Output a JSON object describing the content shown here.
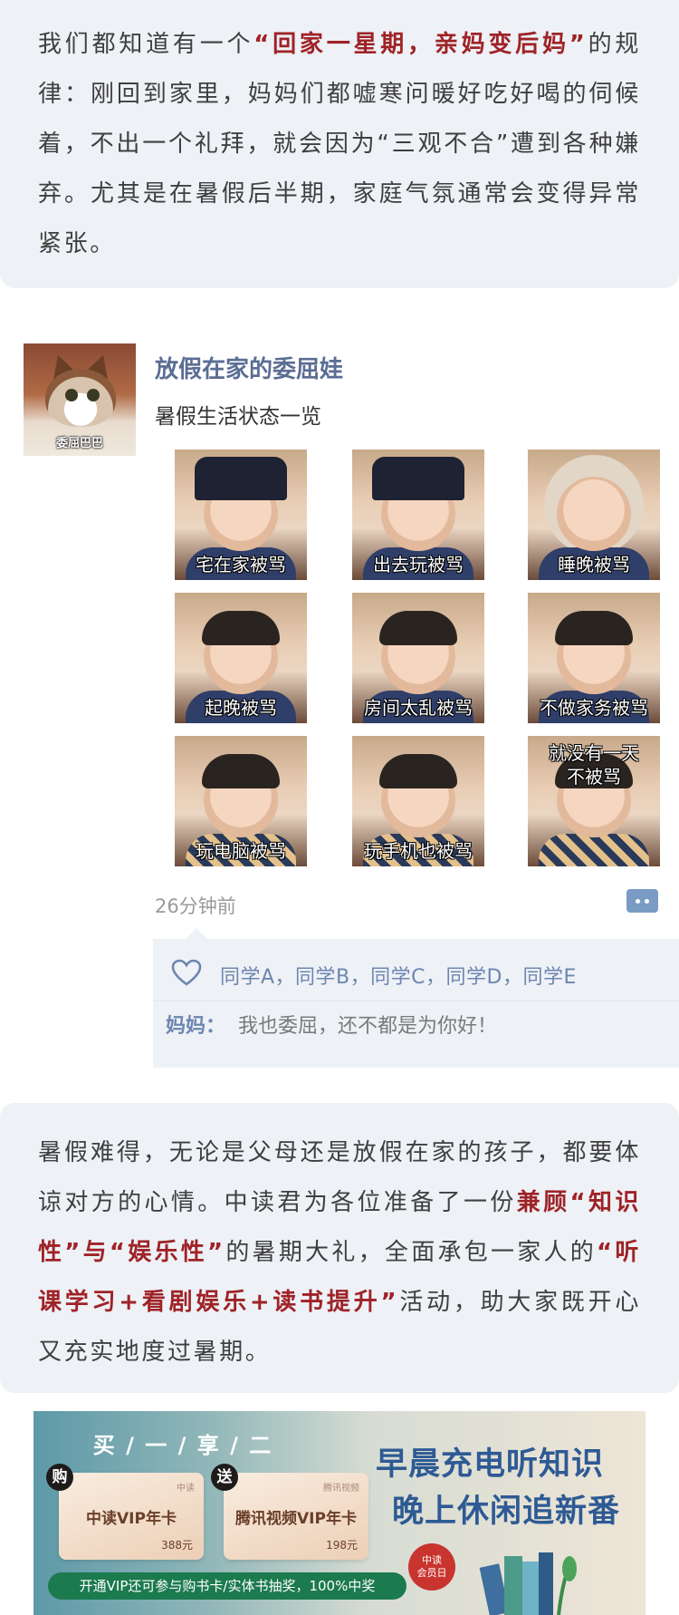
{
  "intro": {
    "pre": "我们都知道有一个",
    "highlight": "“回家一星期，亲妈变后妈”",
    "post": "的规律：刚回到家里，妈妈们都嘘寒问暖好吃好喝的伺候着，不出一个礼拜，就会因为“三观不合”遭到各种嫌弃。尤其是在暑假后半期，家庭气氛通常会变得异常紧张。"
  },
  "post": {
    "avatar_caption": "委屈巴巴",
    "nickname": "放假在家的委屈娃",
    "text": "暑假生活状态一览",
    "images": [
      {
        "caption": "宅在家被骂",
        "style": "hat"
      },
      {
        "caption": "出去玩被骂",
        "style": "hat"
      },
      {
        "caption": "睡晚被骂",
        "style": "hood"
      },
      {
        "caption": "起晚被骂",
        "style": "hair"
      },
      {
        "caption": "房间太乱被骂",
        "style": "hair"
      },
      {
        "caption": "不做家务被骂",
        "style": "hair"
      },
      {
        "caption": "玩电脑被骂",
        "style": "check"
      },
      {
        "caption": "玩手机也被骂",
        "style": "check"
      },
      {
        "caption": "就没有一天\n不被骂",
        "style": "check"
      }
    ],
    "time": "26分钟前",
    "likes": "同学A，同学B，同学C，同学D，同学E",
    "comment": {
      "name": "妈妈：",
      "text": "我也委屈，还不都是为你好！"
    }
  },
  "outro": {
    "p1": "暑假难得，无论是父母还是放假在家的孩子，都要体谅对方的心情。中读君为各位准备了一份",
    "h1": "兼顾“知识性”与“娱乐性”",
    "p2": "的暑期大礼，全面承包一家人的",
    "h2": "“听课学习+看剧娱乐+读书提升”",
    "p3": "活动，助大家既开心又充实地度过暑期。"
  },
  "banner": {
    "head": "买 / 一 / 享 / 二",
    "tag_buy": "购",
    "tag_gift": "送",
    "ticket1": {
      "name": "中读VIP年卡",
      "price": "388元",
      "logo": "中读"
    },
    "ticket2": {
      "name": "腾讯视频VIP年卡",
      "price": "198元",
      "logo": "腾讯视频"
    },
    "bar": "开通VIP还可参与购书卡/实体书抽奖，100%中奖",
    "slogan1": "早晨充电听知识",
    "slogan2": "晚上休闲追新番",
    "badge": "中读\n会员日"
  },
  "colors": {
    "card_bg": "#eef1f6",
    "highlight": "#9e2327",
    "link_blue": "#6d86b0",
    "nickname": "#5b6d93"
  }
}
